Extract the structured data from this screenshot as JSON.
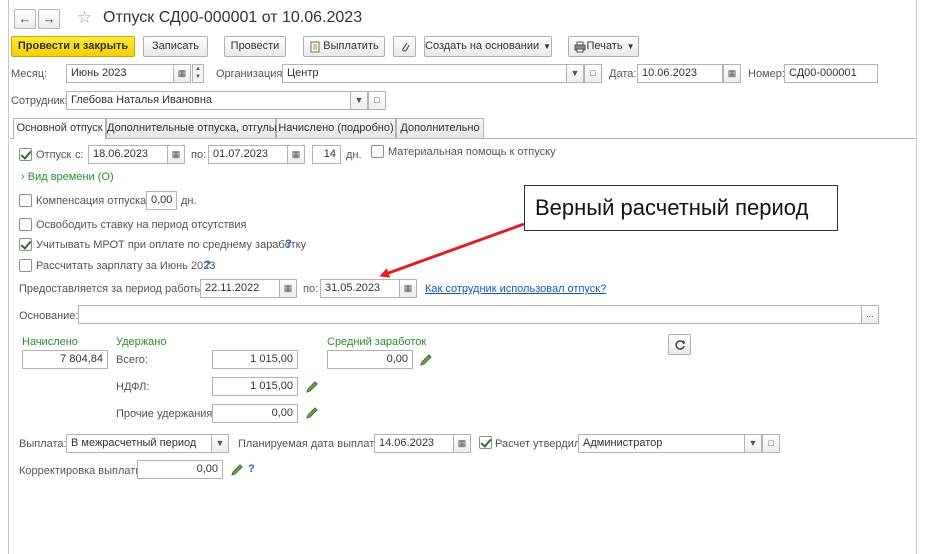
{
  "header": {
    "title": "Отпуск СД00-000001 от 10.06.2023",
    "back_icon": "arrow-left-icon",
    "forward_icon": "arrow-right-icon",
    "favorite_icon": "star-icon"
  },
  "toolbar": {
    "post_close": "Провести и закрыть",
    "save": "Записать",
    "post": "Провести",
    "payout": "Выплатить",
    "create_based": "Создать на основании",
    "print": "Печать"
  },
  "row1": {
    "month_label": "Месяц:",
    "month_value": "Июнь 2023",
    "org_label": "Организация:",
    "org_value": "Центр",
    "date_label": "Дата:",
    "date_value": "10.06.2023",
    "number_label": "Номер:",
    "number_value": "СД00-000001"
  },
  "employee": {
    "label": "Сотрудник:",
    "value": "Глебова Наталья Ивановна"
  },
  "tabs": [
    {
      "label": "Основной отпуск"
    },
    {
      "label": "Дополнительные отпуска, отгулы"
    },
    {
      "label": "Начислено (подробно)"
    },
    {
      "label": "Дополнительно"
    }
  ],
  "vacation": {
    "checkbox_label": "Отпуск",
    "from_label": "с:",
    "from_value": "18.06.2023",
    "to_label": "по:",
    "to_value": "01.07.2023",
    "days_value": "14",
    "days_unit": "дн.",
    "material_help": "Материальная помощь к отпуску",
    "time_kind": "Вид времени (О)",
    "compensation_label": "Компенсация отпуска",
    "compensation_value": "0,00",
    "compensation_unit": "дн.",
    "free_rate": "Освободить ставку на период отсутствия",
    "mrot": "Учитывать МРОТ при оплате по среднему заработку",
    "calc_salary": "Рассчитать зарплату за Июнь 2023",
    "period_label": "Предоставляется за период работы с:",
    "period_from": "22.11.2022",
    "period_to_label": "по:",
    "period_to": "31.05.2023",
    "how_used_link": "Как сотрудник использовал отпуск?",
    "basis_label": "Основание:",
    "basis_value": ""
  },
  "totals": {
    "accrued_label": "Начислено",
    "accrued_value": "7 804,84",
    "withheld_label": "Удержано",
    "total_label": "Всего:",
    "total_value": "1 015,00",
    "ndfl_label": "НДФЛ:",
    "ndfl_value": "1 015,00",
    "other_label": "Прочие удержания:",
    "other_value": "0,00",
    "avg_label": "Средний заработок",
    "avg_value": "0,00"
  },
  "payout": {
    "label": "Выплата:",
    "value": "В межрасчетный период",
    "planned_label": "Планируемая дата выплаты:",
    "planned_value": "14.06.2023",
    "approved_label": "Расчет утвердил",
    "approved_value": "Администратор",
    "correction_label": "Корректировка выплаты:",
    "correction_value": "0,00"
  },
  "annotation": {
    "text": "Верный расчетный период",
    "color": "#e02020"
  },
  "colors": {
    "primary_button": "#f5d000",
    "green_label": "#2e8b2e",
    "link": "#1a57b5"
  }
}
